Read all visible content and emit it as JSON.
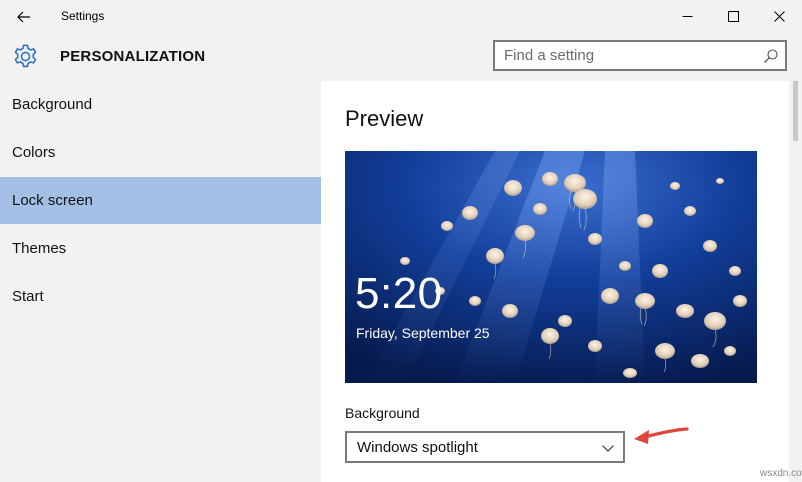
{
  "window": {
    "app_title": "Settings"
  },
  "header": {
    "section_title": "PERSONALIZATION",
    "search_placeholder": "Find a setting"
  },
  "sidebar": {
    "items": [
      {
        "label": "Background",
        "selected": false
      },
      {
        "label": "Colors",
        "selected": false
      },
      {
        "label": "Lock screen",
        "selected": true
      },
      {
        "label": "Themes",
        "selected": false
      },
      {
        "label": "Start",
        "selected": false
      }
    ]
  },
  "content": {
    "title": "Preview",
    "preview": {
      "time": "5:20",
      "date": "Friday, September 25"
    },
    "background_label": "Background",
    "background_value": "Windows spotlight"
  },
  "icons": {
    "back": "back-arrow-icon",
    "minimize": "minimize-icon",
    "maximize": "maximize-icon",
    "close": "close-icon",
    "gear": "gear-icon",
    "search": "search-icon",
    "dropdown": "chevron-down-icon"
  },
  "colors": {
    "accent_selected": "#a4bfe6",
    "chrome": "#f2f2f2",
    "annotation_arrow": "#e0463c",
    "gear_blue": "#2a6fc2"
  },
  "watermark": "wsxdn.com"
}
